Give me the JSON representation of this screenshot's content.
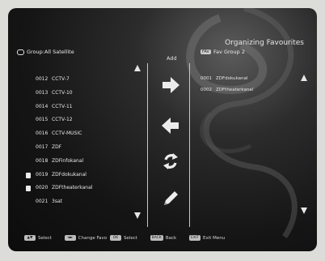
{
  "title": "Organizing Favourites",
  "left_header": "Group:All Satellite",
  "add_label": "Add",
  "right_header": {
    "tag": "FAV",
    "label": "Fav Group 2"
  },
  "channels": [
    {
      "num": "0012",
      "name": "CCTV-7",
      "checked": false
    },
    {
      "num": "0013",
      "name": "CCTV-10",
      "checked": false
    },
    {
      "num": "0014",
      "name": "CCTV-11",
      "checked": false
    },
    {
      "num": "0015",
      "name": "CCTV-12",
      "checked": false
    },
    {
      "num": "0016",
      "name": "CCTV-MUSIC",
      "checked": false
    },
    {
      "num": "0017",
      "name": "ZDF",
      "checked": false
    },
    {
      "num": "0018",
      "name": "ZDFinfokanal",
      "checked": false
    },
    {
      "num": "0019",
      "name": "ZDFdokukanal",
      "checked": true
    },
    {
      "num": "0020",
      "name": "ZDFtheaterkanal",
      "checked": true
    },
    {
      "num": "0021",
      "name": "3sat",
      "checked": false
    }
  ],
  "favourites": [
    {
      "num": "0001",
      "name": "ZDFdokukanal"
    },
    {
      "num": "0002",
      "name": "ZDFtheaterkanal"
    }
  ],
  "actions": [
    {
      "name": "add-arrow-icon"
    },
    {
      "name": "remove-arrow-icon"
    },
    {
      "name": "move-icon"
    },
    {
      "name": "rename-pencil-icon"
    }
  ],
  "footer": [
    {
      "key": "▲▼",
      "label": "Select"
    },
    {
      "key": "◄►",
      "label": "Change Favo"
    },
    {
      "key": "OK",
      "label": "Select"
    },
    {
      "key": "BACK",
      "label": "Back"
    },
    {
      "key": "EXIT",
      "label": "Exit Menu"
    }
  ],
  "colors": {
    "background": "#151515",
    "text": "#e8e8e8",
    "key": "#bdbdbd"
  }
}
